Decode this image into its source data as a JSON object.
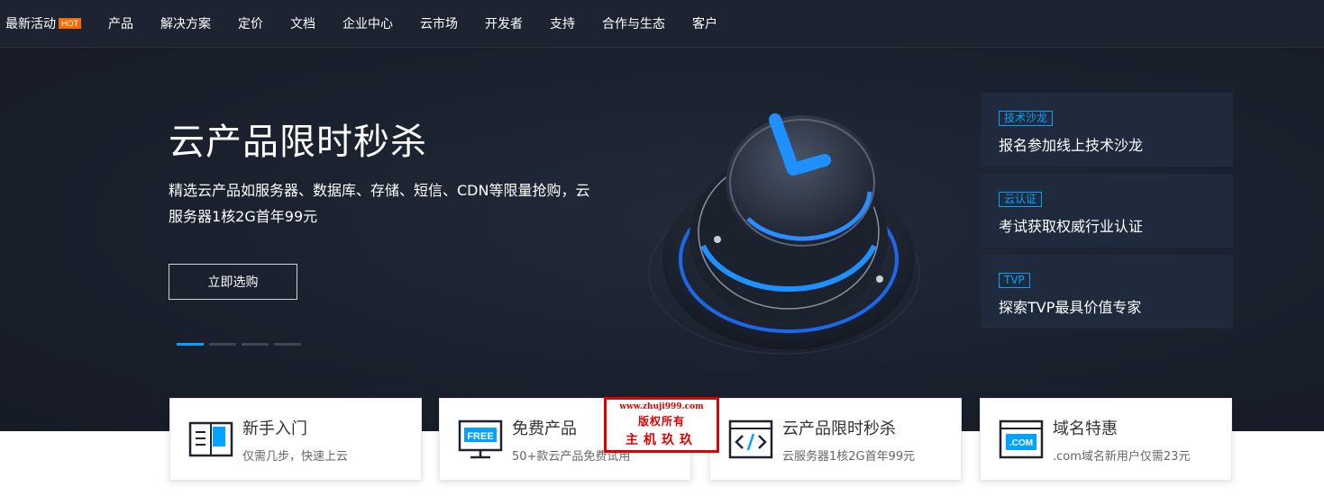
{
  "nav": {
    "hot_badge": "HOT",
    "items": [
      "最新活动",
      "产品",
      "解决方案",
      "定价",
      "文档",
      "企业中心",
      "云市场",
      "开发者",
      "支持",
      "合作与生态",
      "客户"
    ]
  },
  "hero": {
    "title": "云产品限时秒杀",
    "description": "精选云产品如服务器、数据库、存储、短信、CDN等限量抢购，云服务器1核2G首年99元",
    "button_label": "立即选购",
    "slide_count": 4,
    "active_slide": 1
  },
  "side_cards": [
    {
      "tag": "技术沙龙",
      "text": "报名参加线上技术沙龙"
    },
    {
      "tag": "云认证",
      "text": "考试获取权威行业认证"
    },
    {
      "tag": "TVP",
      "text": "探索TVP最具价值专家"
    }
  ],
  "quick_links": [
    {
      "title": "新手入门",
      "subtitle": "仅需几步，快速上云",
      "icon": "book-icon"
    },
    {
      "title": "免费产品",
      "subtitle": "50+款云产品免费试用",
      "icon": "free-screen-icon",
      "icon_label": "FREE"
    },
    {
      "title": "云产品限时秒杀",
      "subtitle": "云服务器1核2G首年99元",
      "icon": "code-window-icon"
    },
    {
      "title": "域名特惠",
      "subtitle": ".com域名新用户仅需23元",
      "icon": "domain-com-icon",
      "icon_label": ".COM"
    }
  ],
  "watermark": {
    "url": "www.zhuji999.com",
    "line2": "版权所有",
    "line3": "主机玖玖"
  },
  "colors": {
    "nav_bg": "#1d2331",
    "hero_bg": "#1a202d",
    "accent": "#00a3ff",
    "hot_badge": "#ff6a00",
    "side_card_bg": "#1f2b3d",
    "watermark_red": "#e00000"
  }
}
